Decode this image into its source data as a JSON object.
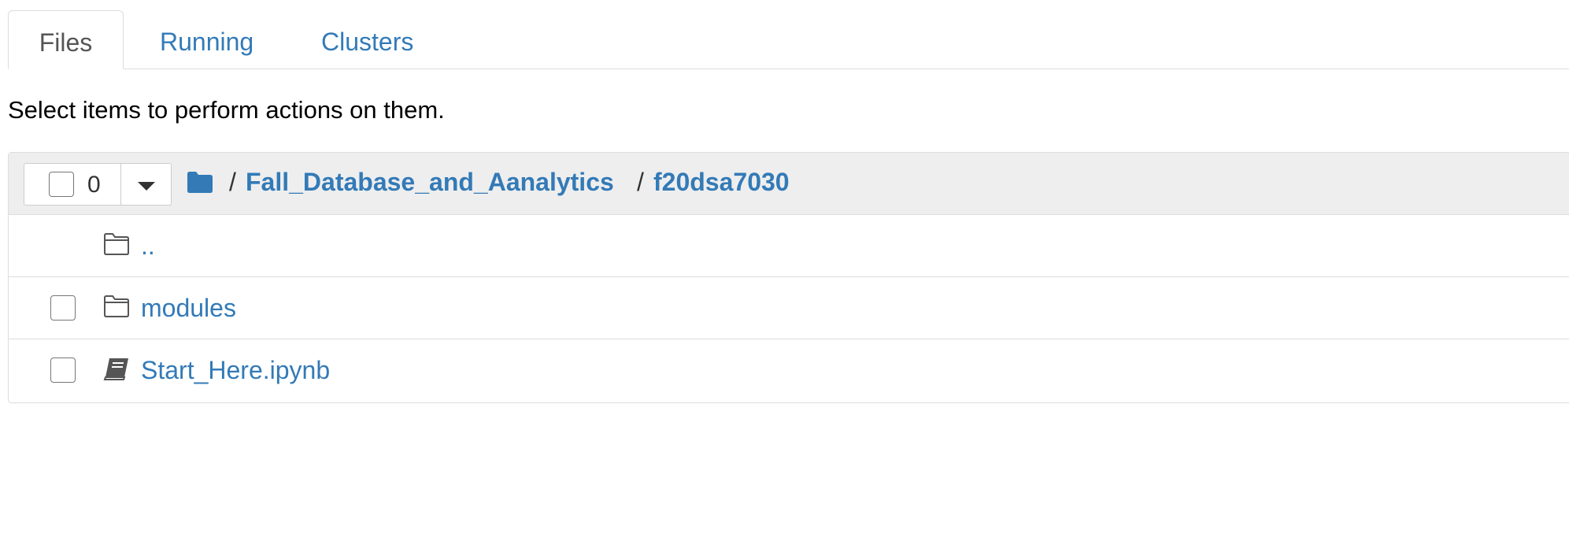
{
  "tabs": [
    {
      "label": "Files"
    },
    {
      "label": "Running"
    },
    {
      "label": "Clusters"
    }
  ],
  "instructions": "Select items to perform actions on them.",
  "toolbar": {
    "selected_count": "0"
  },
  "breadcrumb": {
    "separator": "/",
    "items": [
      {
        "label": "Fall_Database_and_Aanalytics"
      },
      {
        "label": "f20dsa7030"
      }
    ]
  },
  "items": [
    {
      "name": "..",
      "icon": "folder-outline-icon",
      "selectable": false
    },
    {
      "name": "modules",
      "icon": "folder-outline-icon",
      "selectable": true
    },
    {
      "name": "Start_Here.ipynb",
      "icon": "notebook-icon",
      "selectable": true
    }
  ],
  "colors": {
    "link": "#337ab7",
    "header_bg": "#eeeeee",
    "border": "#dddddd"
  }
}
